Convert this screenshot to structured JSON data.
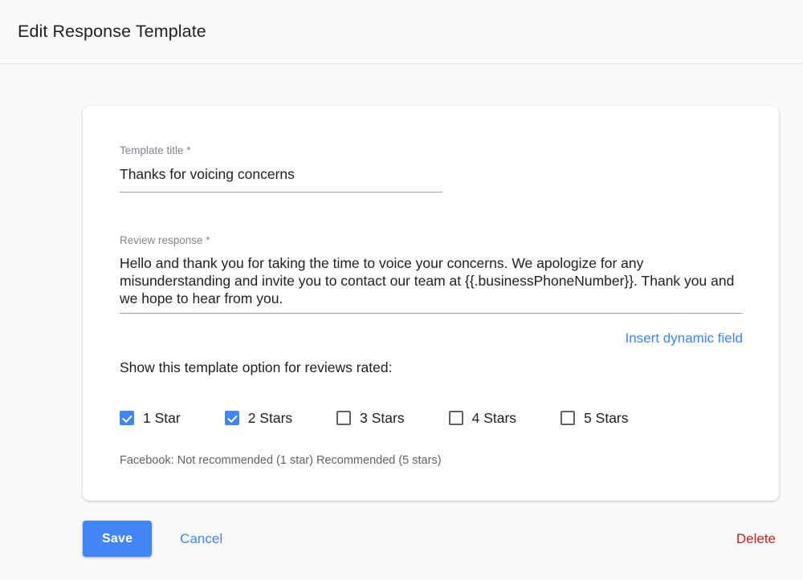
{
  "header": {
    "title": "Edit Response Template"
  },
  "form": {
    "title_field": {
      "label": "Template title *",
      "value": "Thanks for voicing concerns"
    },
    "response_field": {
      "label": "Review response *",
      "value": "Hello and thank you for taking the time to voice your concerns. We apologize for any misunderstanding and invite you to contact our team at {{.businessPhoneNumber}}. Thank you and we hope to hear from you."
    },
    "insert_dynamic_field_link": "Insert dynamic field",
    "rating_prompt": "Show this template option for reviews rated:",
    "rating_options": [
      {
        "label": "1 Star",
        "checked": true
      },
      {
        "label": "2 Stars",
        "checked": true
      },
      {
        "label": "3 Stars",
        "checked": false
      },
      {
        "label": "4 Stars",
        "checked": false
      },
      {
        "label": "5 Stars",
        "checked": false
      }
    ],
    "footnote": "Facebook: Not recommended (1 star) Recommended (5 stars)"
  },
  "actions": {
    "save_label": "Save",
    "cancel_label": "Cancel",
    "delete_label": "Delete"
  },
  "colors": {
    "accent_blue": "#4285f4",
    "delete_red": "#c5221f",
    "page_background": "#fafafa",
    "card_background": "#ffffff",
    "primary_text": "#202124",
    "secondary_text": "#5f6368",
    "label_text": "#80868b"
  }
}
